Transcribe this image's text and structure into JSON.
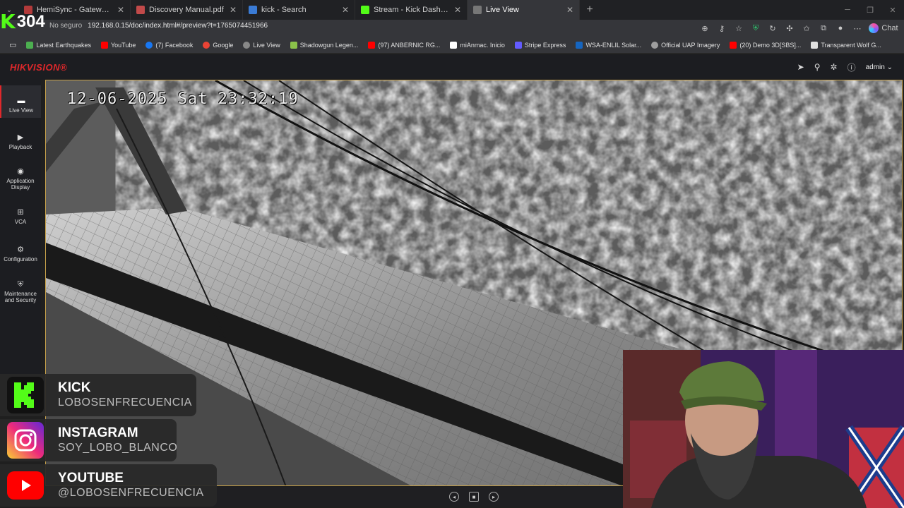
{
  "browser": {
    "tabs": [
      {
        "title": "HemiSync - Gateway Experience -",
        "fav_color": "#b23a3a",
        "active": false
      },
      {
        "title": "Discovery Manual.pdf",
        "fav_color": "#c24a4a",
        "active": false
      },
      {
        "title": "kick - Search",
        "fav_color": "#3a7bd5",
        "active": false
      },
      {
        "title": "Stream - Kick Dashboard",
        "fav_color": "#53fc18",
        "active": false
      },
      {
        "title": "Live View",
        "fav_color": "#777777",
        "active": true
      }
    ],
    "new_tab": "+",
    "close_glyph": "✕",
    "address": {
      "not_secure": "No seguro",
      "url": "192.168.0.15/doc/index.html#/preview?t=1765074451966"
    },
    "chat_label": "Chat",
    "bookmarks": [
      {
        "label": "Latest Earthquakes",
        "color": "#4caf50"
      },
      {
        "label": "YouTube",
        "color": "#ff0000"
      },
      {
        "label": "(7) Facebook",
        "color": "#1877f2"
      },
      {
        "label": "Google",
        "color": "#ea4335"
      },
      {
        "label": "Live View",
        "color": "#888888"
      },
      {
        "label": "Shadowgun Legen...",
        "color": "#8bc34a"
      },
      {
        "label": "(97) ANBERNIC RG...",
        "color": "#ff0000"
      },
      {
        "label": "miAnmac. Inicio",
        "color": "#ffffff"
      },
      {
        "label": "Stripe Express",
        "color": "#635bff"
      },
      {
        "label": "WSA-ENLIL Solar...",
        "color": "#1565c0"
      },
      {
        "label": "Official UAP Imagery",
        "color": "#9e9e9e"
      },
      {
        "label": "(20) Demo 3D[SBS]...",
        "color": "#ff0000"
      },
      {
        "label": "Transparent Wolf G...",
        "color": "#e0e0e0"
      }
    ]
  },
  "overlay_counter": {
    "k": "K",
    "value": "304"
  },
  "hikvision": {
    "logo": "HIKVISION®",
    "user": "admin",
    "nav": [
      {
        "label": "Live View",
        "icon": "live-view-icon",
        "active": true
      },
      {
        "label": "Playback",
        "icon": "playback-icon",
        "active": false
      },
      {
        "label": "Application Display",
        "icon": "application-display-icon",
        "active": false
      },
      {
        "label": "VCA",
        "icon": "vca-icon",
        "active": false
      },
      {
        "label": "Configuration",
        "icon": "configuration-icon",
        "active": false
      },
      {
        "label": "Maintenance and Security",
        "icon": "maintenance-icon",
        "active": false
      }
    ],
    "osd_timestamp": "12-06-2025 Sat 23:32:19"
  },
  "socials": [
    {
      "name": "KICK",
      "handle": "LOBOSENFRECUENCIA",
      "color": "#53fc18"
    },
    {
      "name": "INSTAGRAM",
      "handle": "SOY_LOBO_BLANCO",
      "color": "#e1306c"
    },
    {
      "name": "YOUTUBE",
      "handle": "@LOBOSENFRECUENCIA",
      "color": "#ff0000"
    }
  ]
}
